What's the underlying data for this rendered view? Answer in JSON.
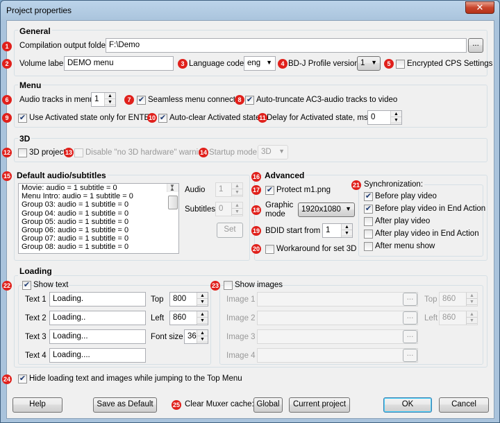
{
  "window": {
    "title": "Project properties",
    "close": "✕"
  },
  "markers": [
    "1",
    "2",
    "3",
    "4",
    "5",
    "6",
    "7",
    "8",
    "9",
    "10",
    "11",
    "12",
    "13",
    "14",
    "15",
    "16",
    "17",
    "18",
    "19",
    "20",
    "21",
    "22",
    "23",
    "24",
    "25"
  ],
  "general": {
    "header": "General",
    "folder_label": "Compilation output folder",
    "folder_value": "F:\\Demo",
    "browse": "...",
    "volume_label": "Volume label",
    "volume_value": "DEMO menu",
    "lang_label": "Language code",
    "lang_value": "eng",
    "bdj_label": "BD-J Profile version",
    "bdj_value": "1",
    "cps_label": "Encrypted CPS Settings"
  },
  "menu": {
    "header": "Menu",
    "audio_tracks_label": "Audio tracks in menu",
    "audio_tracks_value": "1",
    "seamless_label": "Seamless menu connection",
    "autotrunc_label": "Auto-truncate AC3-audio tracks to video",
    "activated_label": "Use Activated state only for ENTER",
    "autoclear_label": "Auto-clear Activated state",
    "delay_label": "Delay for Activated state, ms",
    "delay_value": "0"
  },
  "threed": {
    "header": "3D",
    "project_label": "3D project",
    "disable_label": "Disable \"no 3D hardware\" warning",
    "startup_label": "Startup mode",
    "startup_value": "3D"
  },
  "das": {
    "header": "Default audio/subtitles",
    "items": [
      "Movie:  audio = 1 subtitle = 0",
      "Menu Intro:  audio = 1 subtitle = 0",
      "Group 03:  audio = 1 subtitle = 0",
      "Group 04:  audio = 1 subtitle = 0",
      "Group 05:  audio = 1 subtitle = 0",
      "Group 06:  audio = 1 subtitle = 0",
      "Group 07:  audio = 1 subtitle = 0",
      "Group 08:  audio = 1 subtitle = 0"
    ],
    "audio_label": "Audio",
    "audio_value": "1",
    "subs_label": "Subtitles",
    "subs_value": "0",
    "set_label": "Set"
  },
  "advanced": {
    "header": "Advanced",
    "protect_label": "Protect m1.png",
    "graphic_label1": "Graphic",
    "graphic_label2": "mode",
    "graphic_value": "1920x1080",
    "bdid_label": "BDID start from",
    "bdid_value": "1",
    "workaround_label": "Workaround for set 3D"
  },
  "sync": {
    "header": "Synchronization:",
    "items": [
      "Before play video",
      "Before play video in End Action",
      "After play video",
      "After play video in End Action",
      "After menu show"
    ],
    "checked": [
      true,
      true,
      false,
      false,
      false
    ]
  },
  "loading": {
    "header": "Loading",
    "show_text_label": "Show text",
    "texts": [
      {
        "label": "Text 1",
        "value": "Loading."
      },
      {
        "label": "Text 2",
        "value": "Loading.."
      },
      {
        "label": "Text 3",
        "value": "Loading..."
      },
      {
        "label": "Text 4",
        "value": "Loading...."
      }
    ],
    "top_label": "Top",
    "top_value": "800",
    "left_label": "Left",
    "left_value": "860",
    "fontsize_label": "Font size",
    "fontsize_value": "36",
    "show_images_label": "Show images",
    "images": [
      "Image 1",
      "Image 2",
      "Image 3",
      "Image 4"
    ],
    "img_top_label": "Top",
    "img_top_value": "860",
    "img_left_label": "Left",
    "img_left_value": "860"
  },
  "hide_label": "Hide loading text and images while jumping to the Top Menu",
  "footer": {
    "help": "Help",
    "save_default": "Save as Default",
    "clear_label": "Clear Muxer cache:",
    "global": "Global",
    "current": "Current project",
    "ok": "OK",
    "cancel": "Cancel"
  }
}
